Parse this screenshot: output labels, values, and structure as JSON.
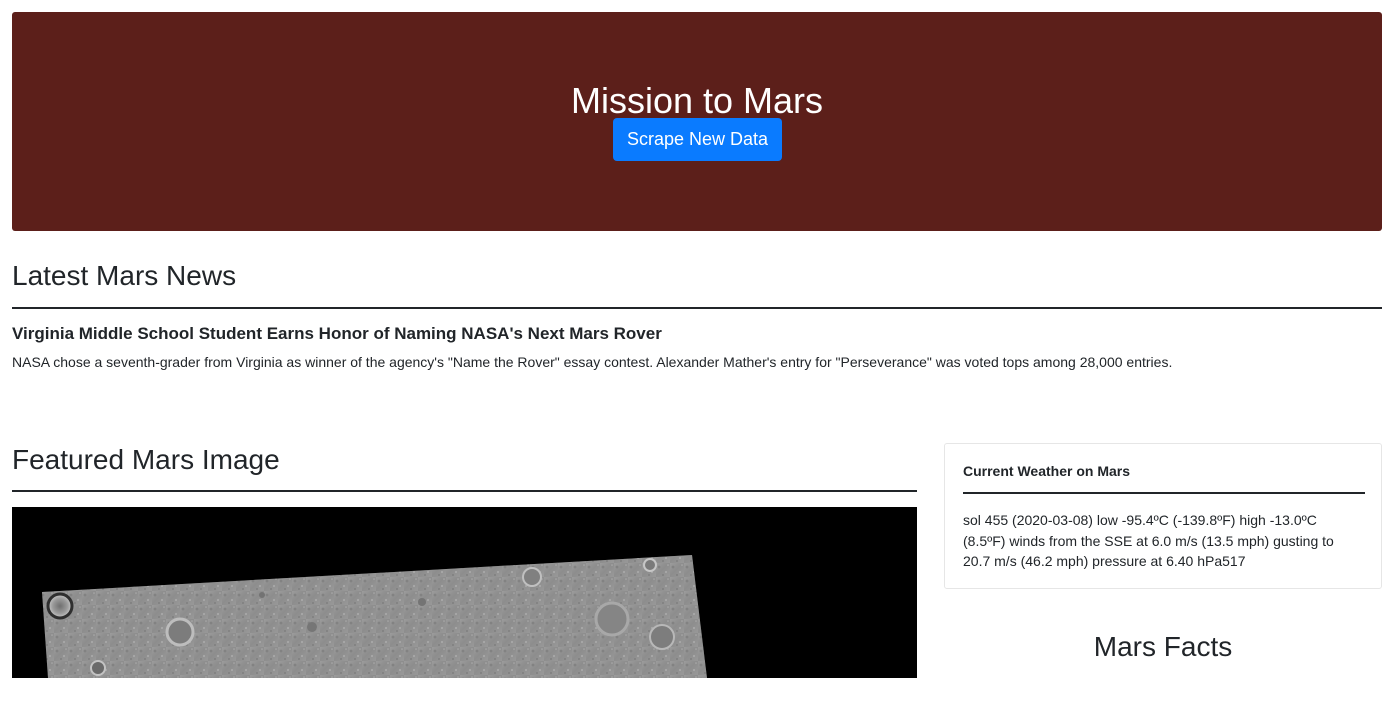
{
  "jumbotron": {
    "title": "Mission to Mars",
    "button_label": "Scrape New Data",
    "background_color": "#5c1f1a",
    "button_color": "#0a7bff"
  },
  "news": {
    "section_title": "Latest Mars News",
    "headline": "Virginia Middle School Student Earns Honor of Naming NASA's Next Mars Rover",
    "paragraph": "NASA chose a seventh-grader from Virginia as winner of the agency's \"Name the Rover\" essay contest. Alexander Mather's entry for \"Perseverance\" was voted tops among 28,000 entries."
  },
  "featured": {
    "section_title": "Featured Mars Image"
  },
  "weather": {
    "title": "Current Weather on Mars",
    "text": "sol 455 (2020-03-08) low -95.4ºC (-139.8ºF) high -13.0ºC (8.5ºF) winds from the SSE at 6.0 m/s (13.5 mph) gusting to 20.7 m/s (46.2 mph) pressure at 6.40 hPa517"
  },
  "facts": {
    "section_title": "Mars Facts"
  }
}
